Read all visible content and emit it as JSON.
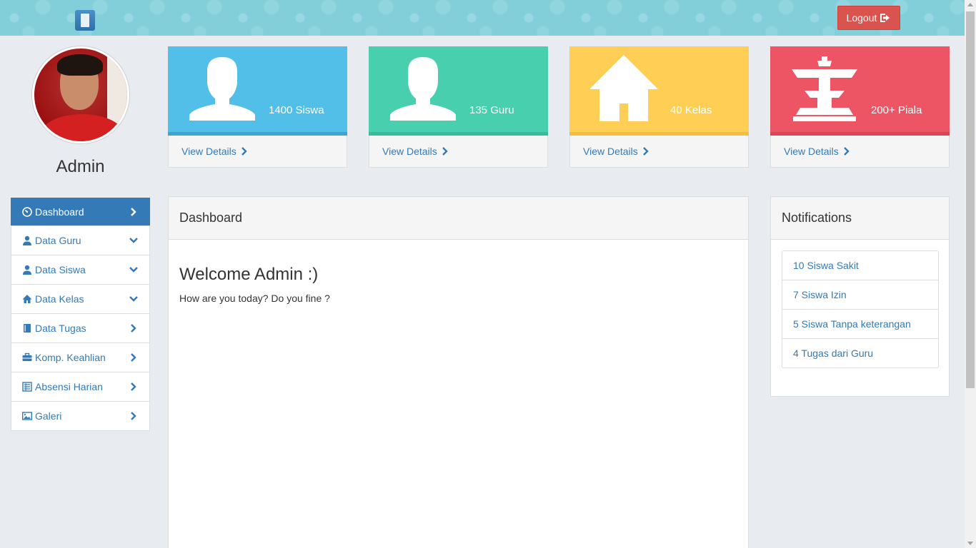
{
  "header": {
    "logout_label": "Logout"
  },
  "profile": {
    "name": "Admin"
  },
  "sidebar": {
    "items": [
      {
        "label": "Dashboard",
        "icon": "dashboard-icon",
        "indicator": "chevron-right-icon",
        "active": true
      },
      {
        "label": "Data Guru",
        "icon": "user-icon",
        "indicator": "chevron-down-icon"
      },
      {
        "label": "Data Siswa",
        "icon": "user-icon",
        "indicator": "chevron-down-icon"
      },
      {
        "label": "Data Kelas",
        "icon": "home-icon",
        "indicator": "chevron-down-icon"
      },
      {
        "label": "Data Tugas",
        "icon": "book-icon",
        "indicator": "chevron-right-icon"
      },
      {
        "label": "Komp. Keahlian",
        "icon": "briefcase-icon",
        "indicator": "chevron-right-icon"
      },
      {
        "label": "Absensi Harian",
        "icon": "list-icon",
        "indicator": "chevron-right-icon"
      },
      {
        "label": "Galeri",
        "icon": "picture-icon",
        "indicator": "chevron-right-icon"
      }
    ]
  },
  "stats": [
    {
      "value": "1400 Siswa",
      "link": "View Details",
      "icon": "user-icon",
      "color": "#52bfe8"
    },
    {
      "value": "135 Guru",
      "link": "View Details",
      "icon": "user-icon",
      "color": "#48cfad"
    },
    {
      "value": "40 Kelas",
      "link": "View Details",
      "icon": "home-icon",
      "color": "#ffce54"
    },
    {
      "value": "200+ Piala",
      "link": "View Details",
      "icon": "tower-icon",
      "color": "#ed5565"
    }
  ],
  "main": {
    "panel_title": "Dashboard",
    "welcome": "Welcome Admin :)",
    "subtitle": "How are you today? Do you fine ?"
  },
  "notifications": {
    "title": "Notifications",
    "items": [
      "10 Siswa Sakit",
      "7 Siswa Izin",
      "5 Siswa Tanpa keterangan",
      "4 Tugas dari Guru"
    ]
  },
  "colors": {
    "primary": "#337ab7",
    "danger": "#d9534f",
    "header": "#82cfda"
  }
}
